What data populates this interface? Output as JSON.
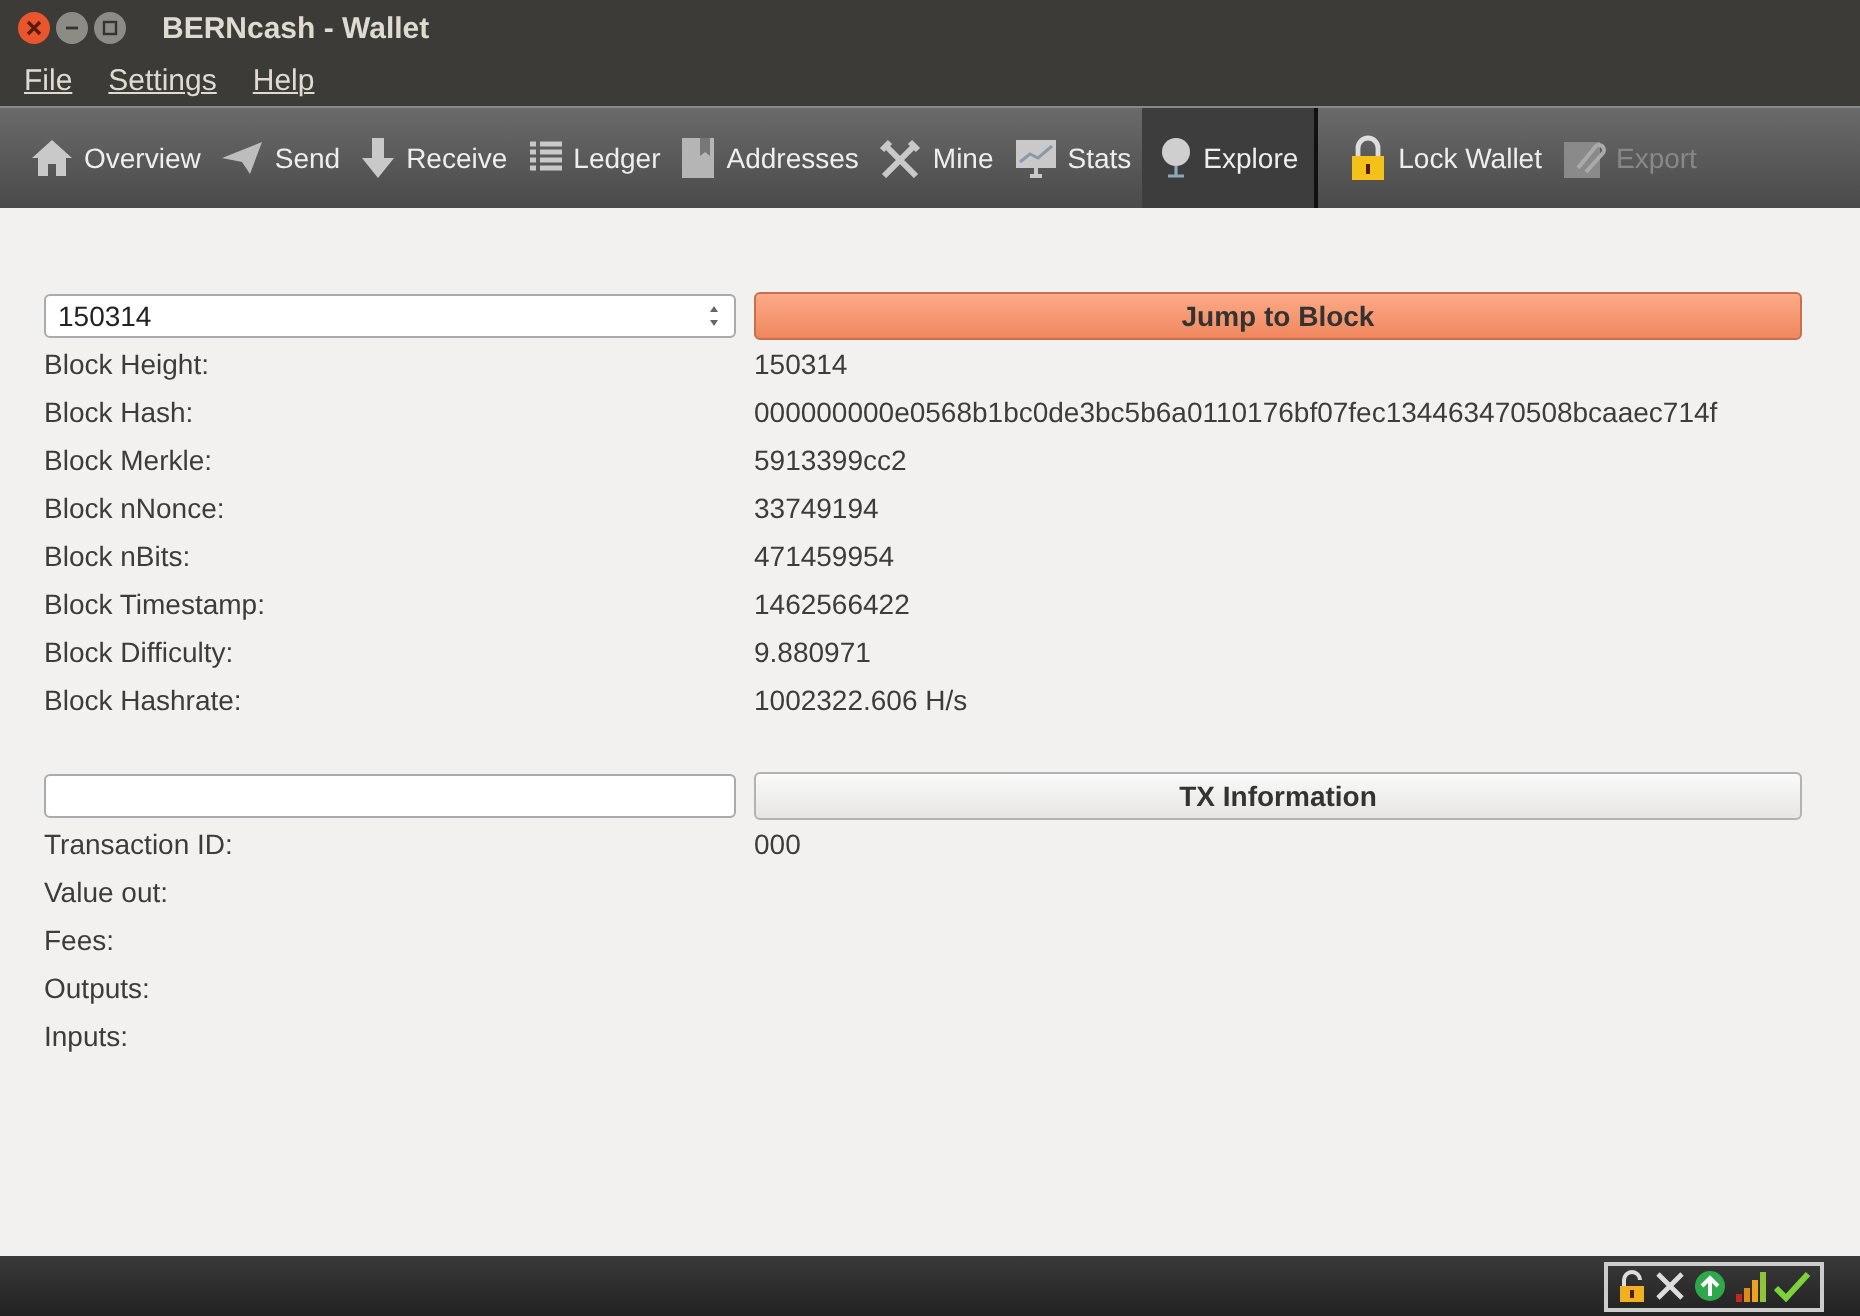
{
  "window": {
    "title": "BERNcash - Wallet"
  },
  "menu": [
    "File",
    "Settings",
    "Help"
  ],
  "toolbar": {
    "tabs": [
      {
        "label": "Overview",
        "selected": false
      },
      {
        "label": "Send",
        "selected": false
      },
      {
        "label": "Receive",
        "selected": false
      },
      {
        "label": "Ledger",
        "selected": false
      },
      {
        "label": "Addresses",
        "selected": false
      },
      {
        "label": "Mine",
        "selected": false
      },
      {
        "label": "Stats",
        "selected": false
      },
      {
        "label": "Explore",
        "selected": true
      }
    ],
    "actions": [
      {
        "label": "Lock Wallet",
        "disabled": false
      },
      {
        "label": "Export",
        "disabled": true
      }
    ]
  },
  "block": {
    "value": "150314",
    "button": "Jump to Block",
    "fields": [
      {
        "label": "Block Height:",
        "value": "150314"
      },
      {
        "label": "Block Hash:",
        "value": "000000000e0568b1bc0de3bc5b6a0110176bf07fec134463470508bcaaec714f"
      },
      {
        "label": "Block Merkle:",
        "value": "5913399cc2"
      },
      {
        "label": "Block nNonce:",
        "value": "33749194"
      },
      {
        "label": "Block nBits:",
        "value": "471459954"
      },
      {
        "label": "Block Timestamp:",
        "value": "1462566422"
      },
      {
        "label": "Block Difficulty:",
        "value": "9.880971"
      },
      {
        "label": "Block Hashrate:",
        "value": "1002322.606 H/s"
      }
    ]
  },
  "tx": {
    "button": "TX Information",
    "fields": [
      {
        "label": "Transaction ID:",
        "value": "000"
      },
      {
        "label": "Value out:"
      },
      {
        "label": "Fees:"
      },
      {
        "label": "Outputs:"
      },
      {
        "label": "Inputs:"
      }
    ]
  }
}
